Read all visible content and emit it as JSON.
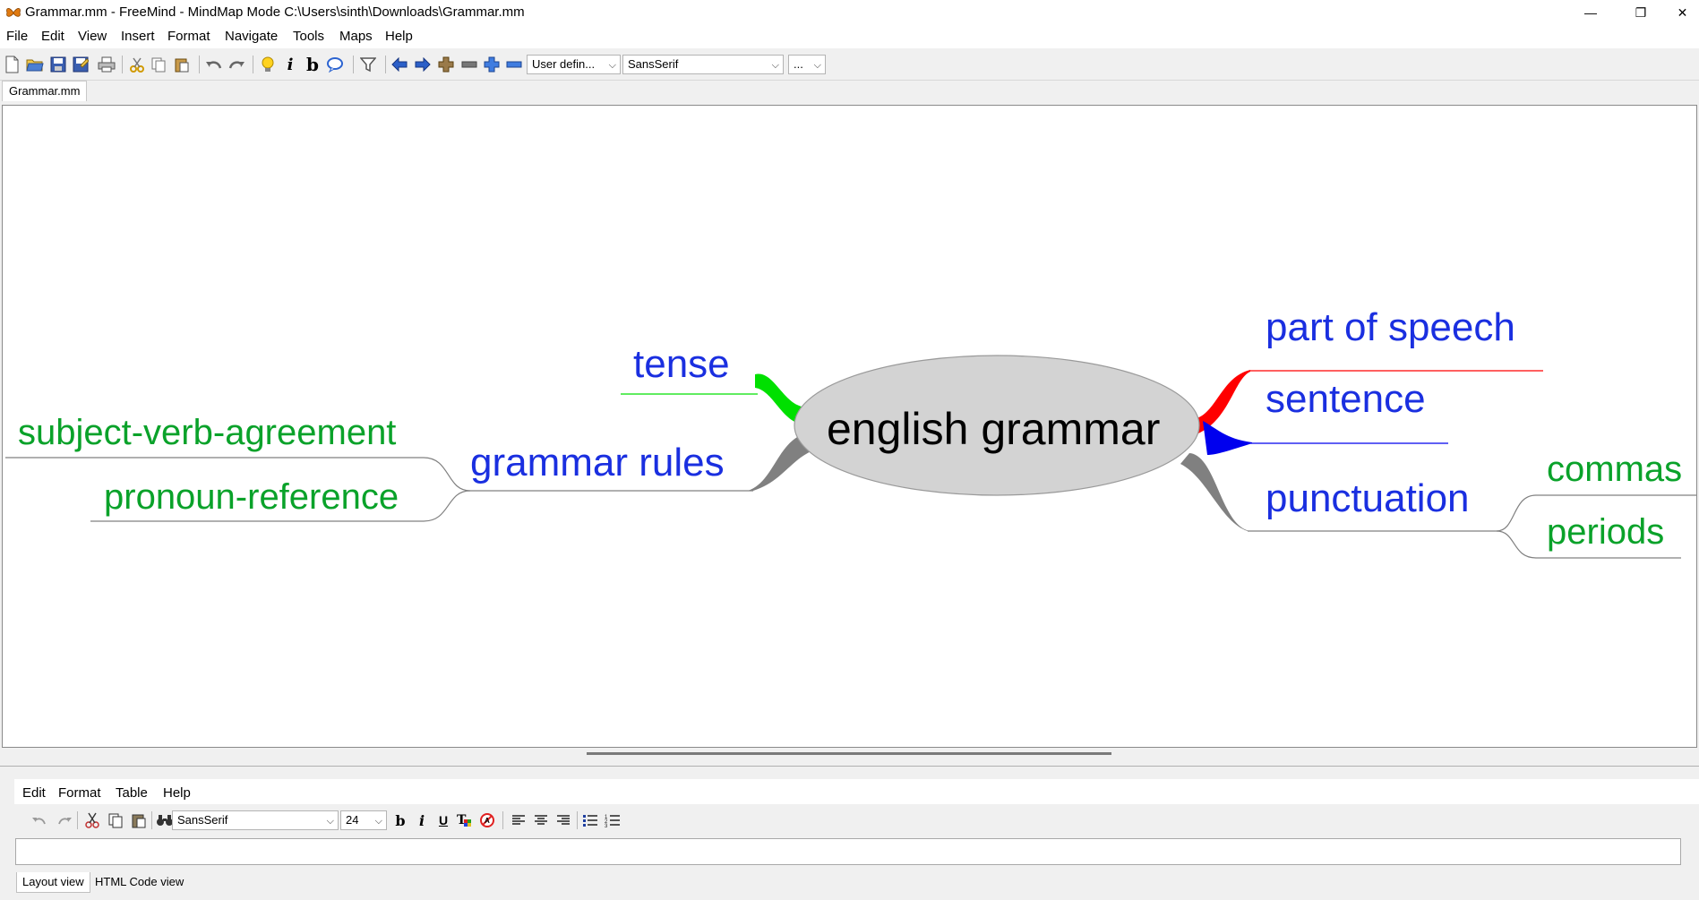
{
  "window": {
    "title": "Grammar.mm - FreeMind - MindMap Mode C:\\Users\\sinth\\Downloads\\Grammar.mm",
    "minimize": "—",
    "restore": "❐",
    "close": "✕"
  },
  "menubar": [
    "File",
    "Edit",
    "View",
    "Insert",
    "Format",
    "Navigate",
    "Tools",
    "Maps",
    "Help"
  ],
  "toolbar": {
    "style_combo": "User defin...",
    "font_combo": "SansSerif",
    "size_combo": "..."
  },
  "tabs": [
    "Grammar.mm"
  ],
  "mindmap": {
    "root": "english grammar",
    "nodes": {
      "tense": "tense",
      "grammar_rules": "grammar rules",
      "subject_verb_agreement": "subject-verb-agreement",
      "pronoun_reference": "pronoun-reference",
      "part_of_speech": "part of speech",
      "sentence": "sentence",
      "punctuation": "punctuation",
      "commas": "commas",
      "periods": "periods"
    },
    "colors": {
      "node_blue": "#1a2fe0",
      "node_green": "#0aa22a",
      "edge_green": "#00e000",
      "edge_red": "#ff0000",
      "edge_blue": "#0000ee",
      "edge_gray": "#808080",
      "root_fill": "#d3d3d3"
    }
  },
  "note_editor": {
    "menubar": [
      "Edit",
      "Format",
      "Table",
      "Help"
    ],
    "font_combo": "SansSerif",
    "size_combo": "24",
    "view_tabs": [
      "Layout view",
      "HTML Code view"
    ]
  }
}
